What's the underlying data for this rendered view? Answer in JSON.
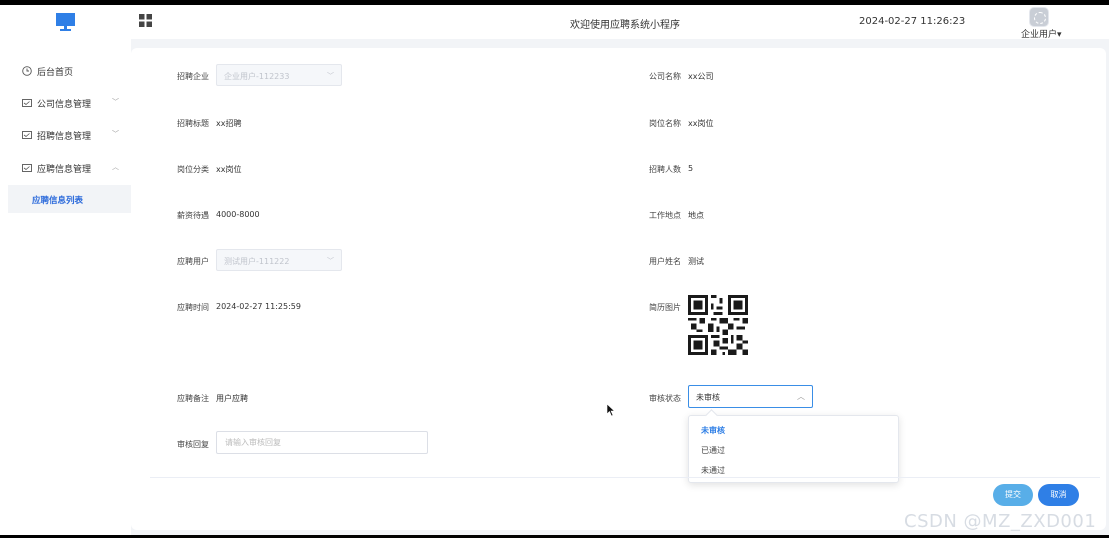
{
  "header": {
    "title": "欢迎使用应聘系统小程序",
    "datetime": "2024-02-27 11:26:23",
    "user_label": "企业用户",
    "user_chevron": "▾"
  },
  "sidebar": {
    "items": [
      {
        "label": "后台首页",
        "icon": "clock-icon"
      },
      {
        "label": "公司信息管理",
        "icon": "card-icon",
        "chevron": "﹀"
      },
      {
        "label": "招聘信息管理",
        "icon": "card-icon",
        "chevron": "﹀"
      },
      {
        "label": "应聘信息管理",
        "icon": "card-icon",
        "chevron": "︿"
      }
    ],
    "sub_item": "应聘信息列表"
  },
  "form": {
    "company_label": "招聘企业",
    "company_value": "企业用户-112233",
    "company_name_label": "公司名称",
    "company_name_value": "xx公司",
    "title_label": "招聘标题",
    "title_value": "xx招聘",
    "position_label": "岗位名称",
    "position_value": "xx岗位",
    "category_label": "岗位分类",
    "category_value": "xx岗位",
    "headcount_label": "招聘人数",
    "headcount_value": "5",
    "salary_label": "薪资待遇",
    "salary_value": "4000-8000",
    "location_label": "工作地点",
    "location_value": "地点",
    "applicant_label": "应聘用户",
    "applicant_value": "测试用户-111222",
    "username_label": "用户姓名",
    "username_value": "测试",
    "time_label": "应聘时间",
    "time_value": "2024-02-27 11:25:59",
    "resume_label": "简历图片",
    "remark_label": "应聘备注",
    "remark_value": "用户应聘",
    "status_label": "审核状态",
    "status_value": "未审核",
    "status_options": [
      "未审核",
      "已通过",
      "未通过"
    ],
    "reply_label": "审核回复",
    "reply_placeholder": "请输入审核回复"
  },
  "buttons": {
    "submit": "提交",
    "cancel": "取消"
  },
  "watermark": "CSDN @MZ_ZXD001",
  "colors": {
    "primary": "#2f7fe6",
    "submit": "#58aee8",
    "background": "#f2f4f7"
  }
}
